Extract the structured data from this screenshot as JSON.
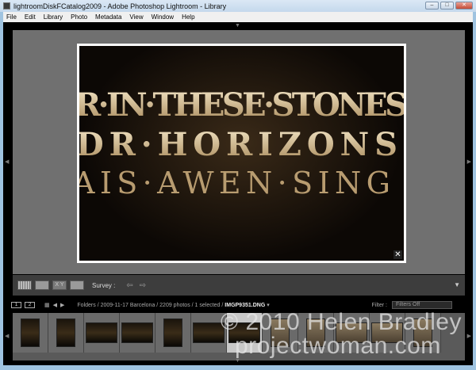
{
  "window": {
    "title": "lightroomDiskFCatalog2009 - Adobe Photoshop Lightroom - Library",
    "buttons": {
      "minimize": "–",
      "maximize": "□",
      "close": "✕"
    }
  },
  "menu": [
    "File",
    "Edit",
    "Library",
    "Photo",
    "Metadata",
    "View",
    "Window",
    "Help"
  ],
  "photo": {
    "lines": [
      "R·IN·THESE·STONES",
      "DR·HORIZONS",
      "AIS·AWEN·SING"
    ],
    "close": "✕"
  },
  "toolbar": {
    "xy": "X Y",
    "survey": "Survey :",
    "prev": "⇦",
    "next": "⇨"
  },
  "filmstrip_header": {
    "monitor1": "1",
    "monitor2": "2",
    "path": "Folders / 2009-11-17 Barcelona / 2209 photos / 1 selected / ",
    "filename": "IMGP9351.DNG",
    "filter_label": "Filter :",
    "filter_value": "Filters Off"
  },
  "filmstrip": {
    "selected_index": 6,
    "count": 12
  },
  "watermark": [
    "© 2010 Helen Bradley",
    "projectwoman.com"
  ]
}
